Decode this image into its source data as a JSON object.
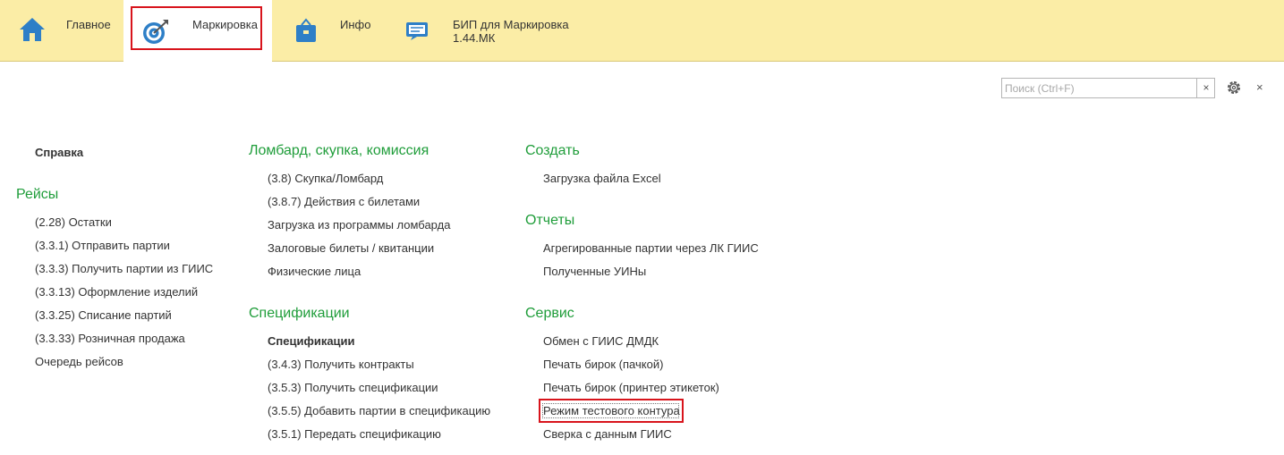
{
  "topbar": {
    "sections": [
      {
        "label": "Главное",
        "icon": "home-icon"
      },
      {
        "label": "Маркировка",
        "icon": "target-icon"
      },
      {
        "label": "Инфо",
        "icon": "briefcase-icon"
      },
      {
        "label": "БИП для Маркировка",
        "label2": "1.44.МК",
        "icon": "message-icon"
      }
    ]
  },
  "search": {
    "placeholder": "Поиск (Ctrl+F)",
    "value": "",
    "clear": "×"
  },
  "window": {
    "close": "×"
  },
  "col1": {
    "title": "Справка",
    "group_title": "Рейсы",
    "items": [
      "(2.28) Остатки",
      "(3.3.1) Отправить партии",
      "(3.3.3) Получить партии из ГИИС",
      "(3.3.13) Оформление изделий",
      "(3.3.25) Списание партий",
      "(3.3.33) Розничная продажа",
      "Очередь рейсов"
    ]
  },
  "col2": {
    "group1_title": "Ломбард, скупка, комиссия",
    "group1_items": [
      "(3.8) Скупка/Ломбард",
      "(3.8.7) Действия с билетами",
      "Загрузка из программы ломбарда",
      "Залоговые билеты / квитанции",
      "Физические лица"
    ],
    "group2_title": "Спецификации",
    "group2_bold": "Спецификации",
    "group2_items": [
      "(3.4.3) Получить контракты",
      "(3.5.3) Получить спецификации",
      "(3.5.5) Добавить партии в спецификацию",
      "(3.5.1) Передать спецификацию"
    ]
  },
  "col3": {
    "group1_title": "Создать",
    "group1_items": [
      "Загрузка файла Excel"
    ],
    "group2_title": "Отчеты",
    "group2_items": [
      "Агрегированные партии через ЛК ГИИС",
      "Полученные УИНы"
    ],
    "group3_title": "Сервис",
    "group3_items": [
      "Обмен с ГИИС ДМДК",
      "Печать бирок (пачкой)",
      "Печать бирок (принтер этикеток)",
      "Режим тестового контура",
      "Сверка с данным ГИИС"
    ]
  },
  "colors": {
    "topbar": "#fbeda6",
    "group": "#1f9d3a",
    "highlight": "#d8141c",
    "icon_blue": "#2e7fc7"
  }
}
